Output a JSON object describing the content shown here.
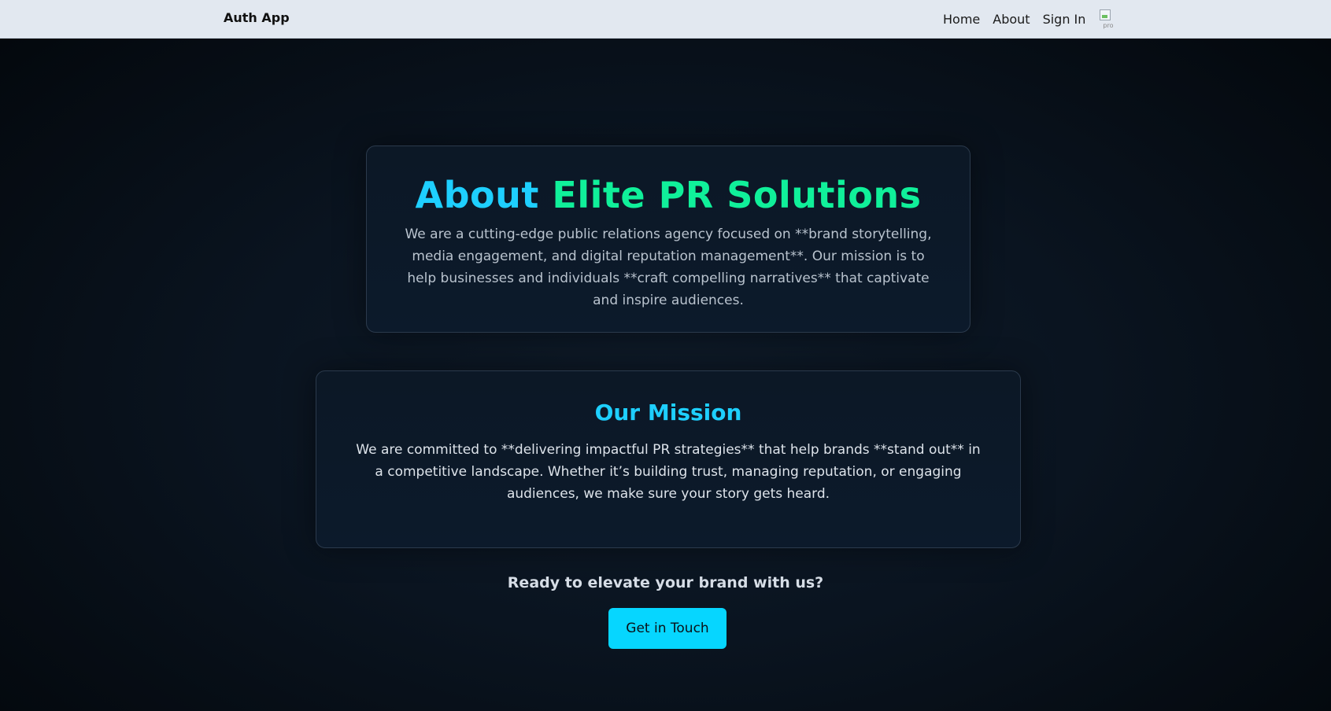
{
  "navbar": {
    "brand": "Auth App",
    "links": [
      {
        "label": "Home"
      },
      {
        "label": "About"
      },
      {
        "label": "Sign In"
      }
    ],
    "avatar_alt": "pro"
  },
  "about": {
    "title_part1": "About",
    "title_part2": "Elite PR Solutions",
    "text": "We are a cutting-edge public relations agency focused on **brand storytelling, media engagement, and digital reputation management**. Our mission is to help businesses and individuals **craft compelling narratives** that captivate and inspire audiences."
  },
  "mission": {
    "title": "Our Mission",
    "text": "We are committed to **delivering impactful PR strategies** that help brands **stand out** in a competitive landscape. Whether it’s building trust, managing reputation, or engaging audiences, we make sure your story gets heard."
  },
  "cta": {
    "heading": "Ready to elevate your brand with us?",
    "button_label": "Get in Touch"
  },
  "colors": {
    "accent_cyan": "#1ecfff",
    "accent_green": "#10f09a",
    "button": "#06d6ff",
    "navbar_bg": "#e2e8f0"
  }
}
